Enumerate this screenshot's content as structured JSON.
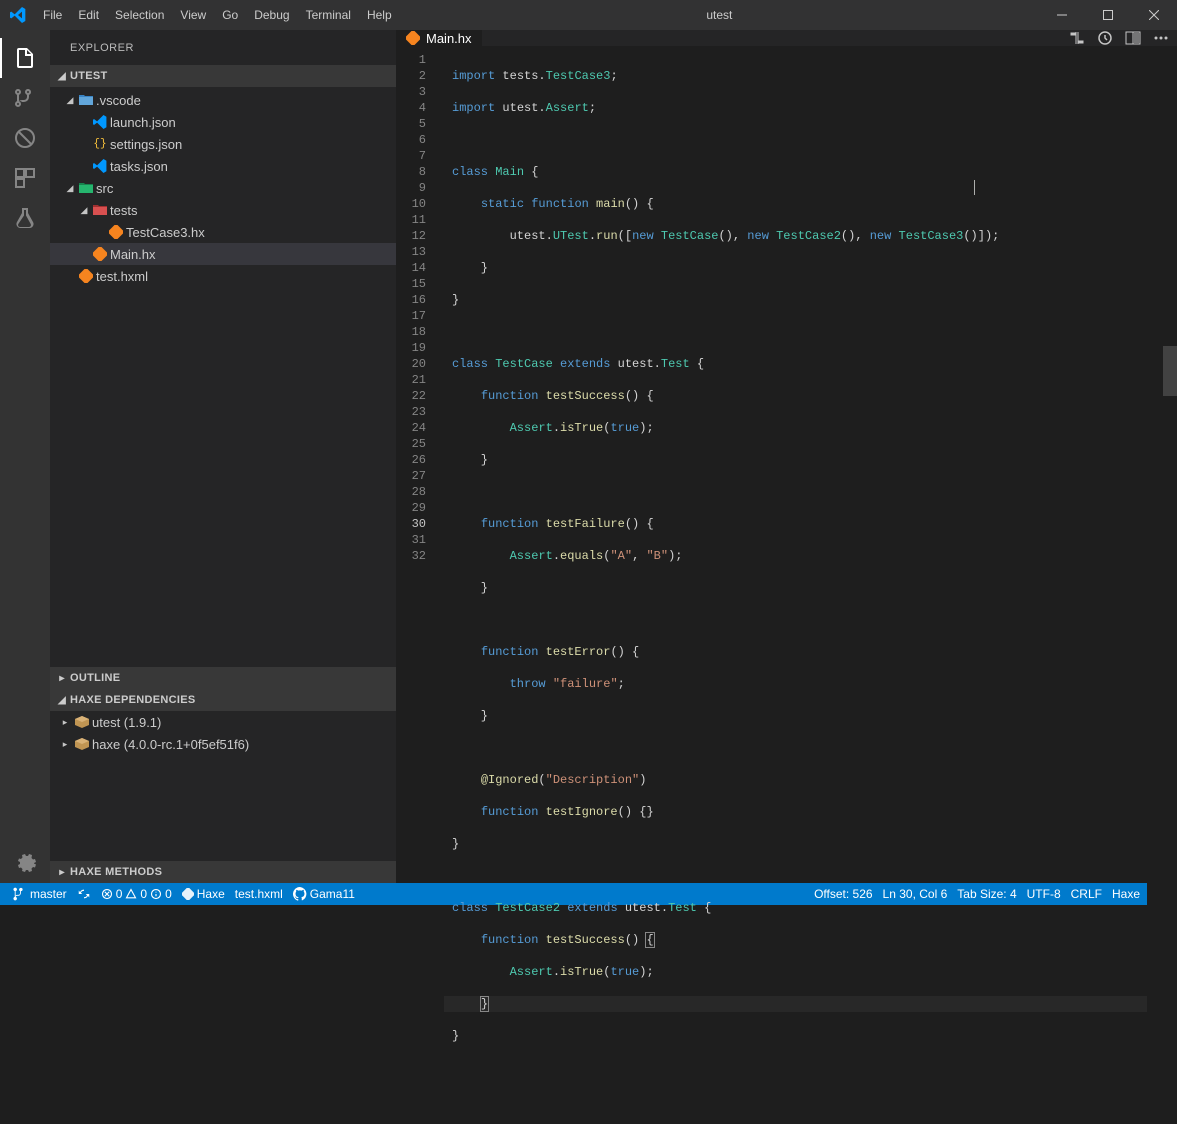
{
  "window": {
    "title": "utest"
  },
  "menu": [
    "File",
    "Edit",
    "Selection",
    "View",
    "Go",
    "Debug",
    "Terminal",
    "Help"
  ],
  "sidebar": {
    "title": "EXPLORER",
    "project": "UTEST",
    "tree": {
      "vscode": {
        "label": ".vscode"
      },
      "launch": {
        "label": "launch.json"
      },
      "settings": {
        "label": "settings.json"
      },
      "tasks": {
        "label": "tasks.json"
      },
      "src": {
        "label": "src"
      },
      "tests": {
        "label": "tests"
      },
      "testcase3": {
        "label": "TestCase3.hx"
      },
      "main": {
        "label": "Main.hx"
      },
      "testhxml": {
        "label": "test.hxml"
      }
    },
    "outline": "OUTLINE",
    "deps": {
      "title": "HAXE DEPENDENCIES",
      "items": [
        "utest (1.9.1)",
        "haxe (4.0.0-rc.1+0f5ef51f6)"
      ]
    },
    "methods": "HAXE METHODS"
  },
  "tabs": {
    "active": "Main.hx"
  },
  "code": {
    "lines": 32
  },
  "status": {
    "branch": "master",
    "errors": "0",
    "warnings": "0",
    "info": "0",
    "lang_server": "Haxe",
    "hxml": "test.hxml",
    "github": "Gama11",
    "offset": "Offset: 526",
    "cursor": "Ln 30, Col 6",
    "tabsize": "Tab Size: 4",
    "encoding": "UTF-8",
    "eol": "CRLF",
    "lang": "Haxe"
  }
}
